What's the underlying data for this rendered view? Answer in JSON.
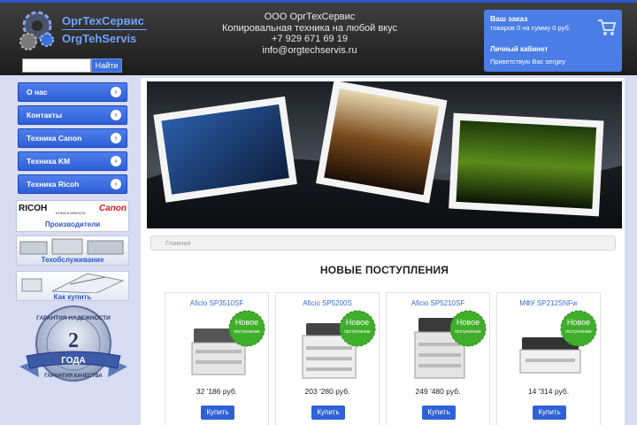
{
  "header": {
    "logo_ru": "ОргТехСервис",
    "logo_en": "OrgTehServis",
    "search_placeholder": "",
    "search_button": "Найти",
    "company": [
      "ООО ОргТехСервис",
      "Копировальная техника на любой вкус",
      "+7 929 671 69 19",
      "info@orgtechservis.ru"
    ],
    "cart": {
      "title": "Ваш заказ",
      "summary": "товаров 0 на сумму 0 руб.",
      "account": "Личный кабинет",
      "greeting": "Приветствую Вас sergey"
    }
  },
  "sidebar": {
    "nav": [
      "О нас",
      "Контакты",
      "Техника Canon",
      "Техника KM",
      "Техника Ricoh"
    ],
    "brands": {
      "ricoh": "RICOH",
      "konica": "KONICA MINOLTA",
      "canon": "Canon",
      "caption": "Производители"
    },
    "service_caption": "Техобслуживание",
    "howbuy_caption": "Как купить",
    "guarantee": {
      "top": "ГАРАНТИЯ НАДЕЖНОСТИ",
      "num": "2",
      "years": "ГОДА",
      "bottom": "ГАРАНТИЯ КАЧЕСТВА"
    }
  },
  "main": {
    "breadcrumb": "Главная",
    "section_title": "НОВЫЕ ПОСТУПЛЕНИЯ",
    "badge": {
      "line1": "Новое",
      "line2": "поступление"
    },
    "products": [
      {
        "name": "Aficio SP3510SF",
        "price": "32 '186 руб.",
        "buy": "Купить"
      },
      {
        "name": "Aficio SP5200S",
        "price": "203 '280 руб.",
        "buy": "Купить"
      },
      {
        "name": "Aficio SP5210SF",
        "price": "249 '480 руб.",
        "buy": "Купить"
      },
      {
        "name": "МФУ SP212SNFw",
        "price": "14 '314 руб.",
        "buy": "Купить"
      }
    ]
  },
  "colors": {
    "accent": "#2f5fd8",
    "header_bg": "#2a2a2a",
    "page_bg": "#d7dcf2",
    "badge_green": "#3fae2a"
  }
}
